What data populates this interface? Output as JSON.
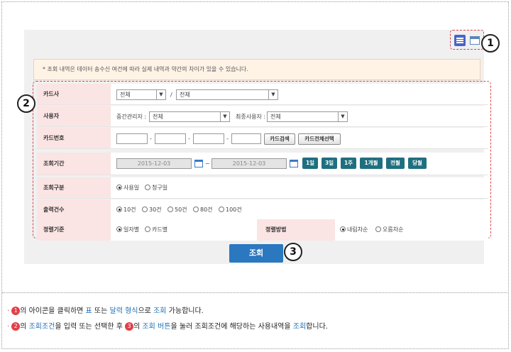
{
  "notice": "* 조회 내역은 데이터 송수신 여건에 따라 실제 내역과 약간의 차이가 있을 수 있습니다.",
  "markers": [
    "1",
    "2",
    "3"
  ],
  "rows": {
    "card_company": {
      "label": "카드사",
      "select1": "전체",
      "sep": "/",
      "select2": "전체"
    },
    "user": {
      "label": "사용자",
      "mid_label": "중간관리자 :",
      "mid_value": "전체",
      "final_label": "최종사용자 :",
      "final_value": "전체"
    },
    "card_number": {
      "label": "카드번호",
      "dash": "-",
      "search_btn": "카드검색",
      "select_all_btn": "카드전체선택"
    },
    "period": {
      "label": "조회기간",
      "from": "2015-12-03",
      "tilde": "~",
      "to": "2015-12-03",
      "quick_buttons": [
        "1일",
        "3일",
        "1주",
        "1개월",
        "전월",
        "당월"
      ]
    },
    "query_type": {
      "label": "조회구분",
      "options": [
        "사용일",
        "청구일"
      ],
      "selected": "사용일"
    },
    "output_count": {
      "label": "출력건수",
      "options": [
        "10건",
        "30건",
        "50건",
        "80건",
        "100건"
      ],
      "selected": "10건"
    },
    "sort": {
      "label": "정렬기준",
      "options": [
        "일자별",
        "카드별"
      ],
      "selected": "일자별",
      "method_label": "정렬방법",
      "method_options": [
        "내림차순",
        "오름차순"
      ],
      "method_selected": "내림차순"
    }
  },
  "search_button": "조회",
  "notes": {
    "line1": {
      "bullet": "·",
      "circle": "①",
      "t1": "의 아이콘을 클릭하면 ",
      "k1": "표",
      "t2": " 또는 ",
      "k2": "달력 형식",
      "t3": "으로 ",
      "k3": "조회",
      "t4": " 가능합니다."
    },
    "line2": {
      "bullet": "·",
      "circle": "②",
      "t1": "의 ",
      "k1": "조회조건",
      "t2": "을 입력 또는 선택한 후 ",
      "circle2": "③",
      "t3": "의 ",
      "k2": "조회 버튼",
      "t4": "을 눌러 조회조건에 해당하는 사용내역을 ",
      "k3": "조회",
      "t5": "합니다."
    }
  },
  "colors": {
    "accent_red": "#e0414a",
    "teal_button": "#1f6f7f",
    "blue_button": "#2a78c0",
    "label_bg": "#fbe4e4"
  }
}
